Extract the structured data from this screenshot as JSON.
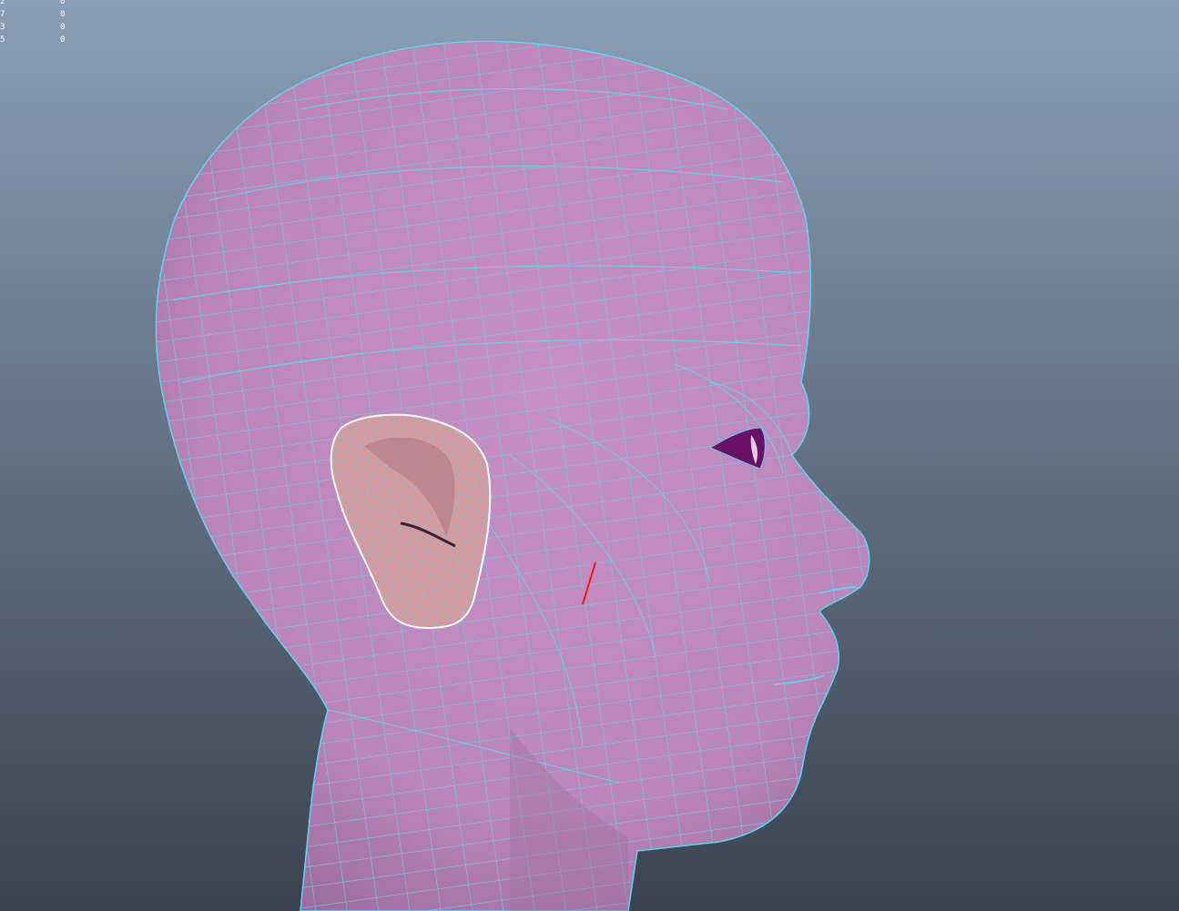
{
  "viewport": {
    "background_top": "#8a9fb5",
    "background_bottom": "#3a4350",
    "mesh_color": "#c08ac0",
    "mesh_shade": "#9f6e9f",
    "wire_color": "#5fd4f0",
    "selected_surface": "#d49aa0",
    "selection_outline": "#ffffff",
    "eye_fill": "#6a1066",
    "manipulator_color": "#ff1010"
  },
  "hud": {
    "rows": [
      {
        "label": "2",
        "value": "0"
      },
      {
        "label": "7",
        "value": "0"
      },
      {
        "label": "3",
        "value": "0"
      },
      {
        "label": "5",
        "value": "0"
      }
    ]
  }
}
